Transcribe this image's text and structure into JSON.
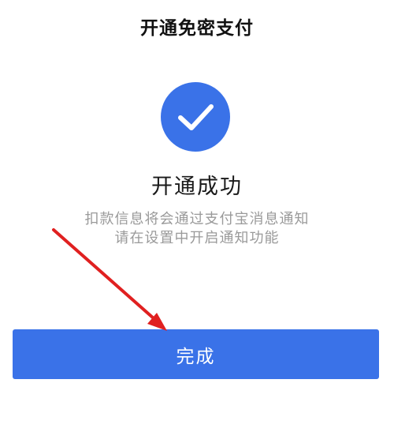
{
  "header": {
    "title": "开通免密支付"
  },
  "result": {
    "icon": "check-icon",
    "title": "开通成功",
    "description_line1": "扣款信息将会通过支付宝消息通知",
    "description_line2": "请在设置中开启通知功能"
  },
  "actions": {
    "done_label": "完成"
  },
  "colors": {
    "accent": "#3a72e8",
    "annotation_arrow": "#e02020"
  }
}
